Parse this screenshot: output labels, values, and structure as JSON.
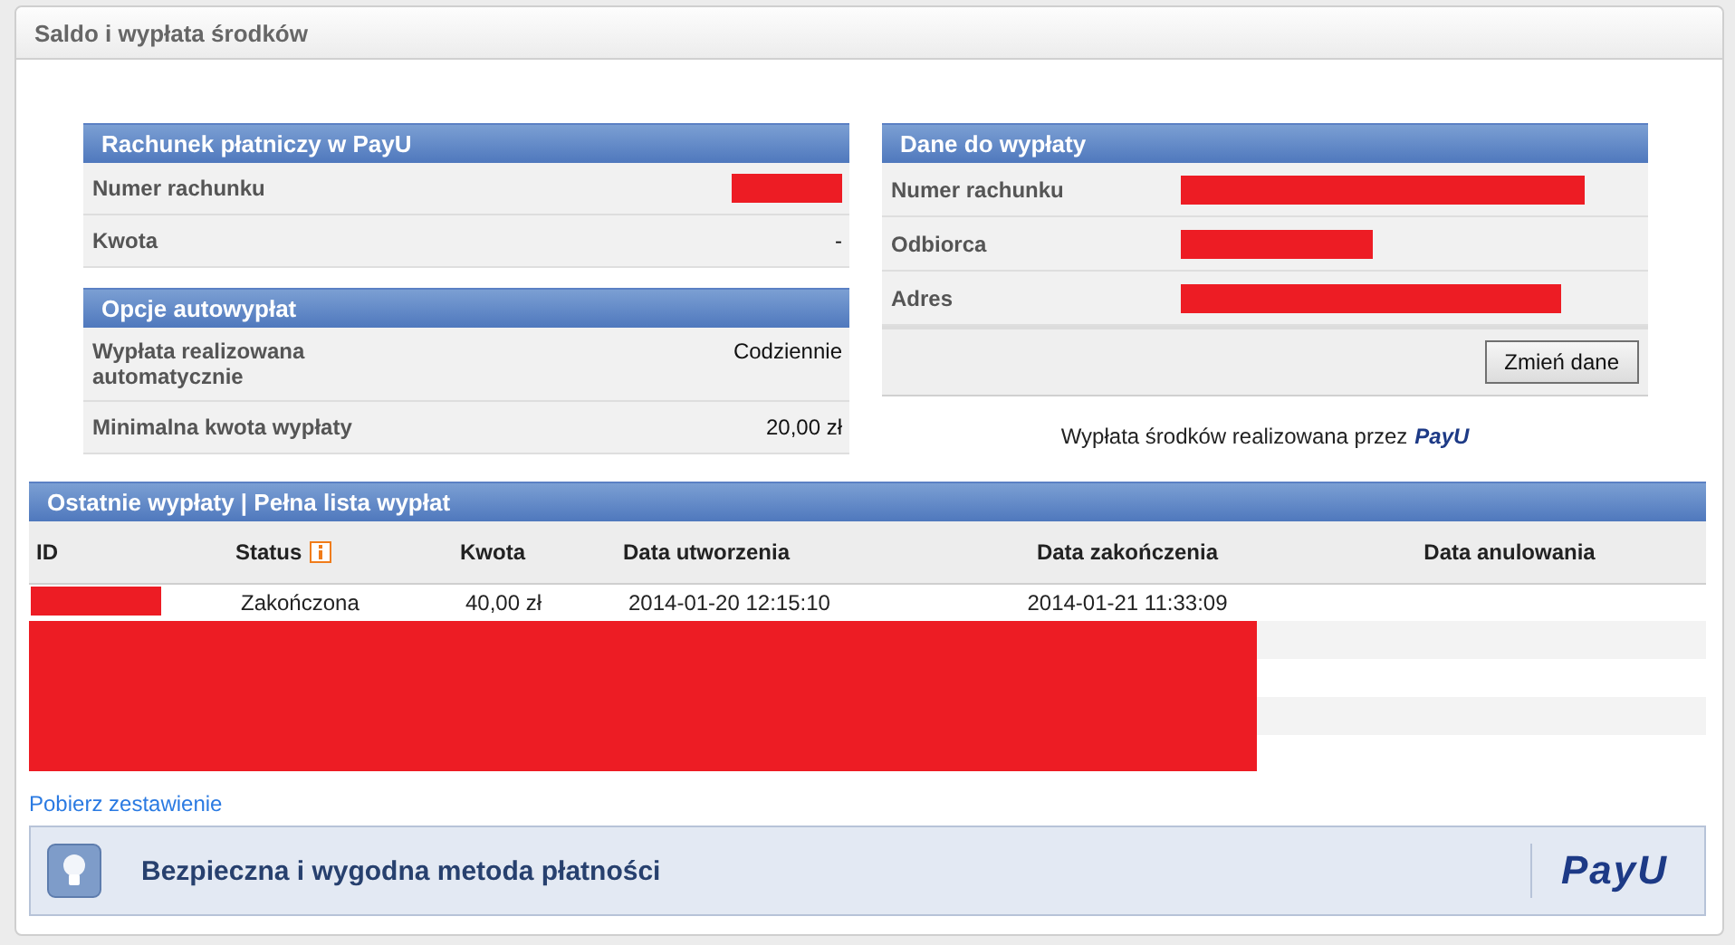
{
  "window": {
    "title": "Saldo i wypłata środków"
  },
  "payu_account": {
    "title": "Rachunek płatniczy w PayU",
    "rows": [
      {
        "label": "Numer rachunku",
        "redacted": true
      },
      {
        "label": "Kwota",
        "value": "-"
      }
    ]
  },
  "autopayout": {
    "title": "Opcje autowypłat",
    "rows": [
      {
        "label": "Wypłata realizowana automatycznie",
        "value": "Codziennie"
      },
      {
        "label": "Minimalna kwota wypłaty",
        "value": "20,00 zł"
      }
    ]
  },
  "payout_details": {
    "title": "Dane do wypłaty",
    "rows": [
      {
        "label": "Numer rachunku",
        "redacted": true
      },
      {
        "label": "Odbiorca",
        "redacted": true
      },
      {
        "label": "Adres",
        "redacted": true
      }
    ],
    "button": "Zmień dane",
    "note": "Wypłata środków realizowana przez",
    "logo": "PayU"
  },
  "payouts": {
    "title": "Ostatnie wypłaty | Pełna lista wypłat",
    "columns": [
      {
        "label": "ID"
      },
      {
        "label": "Status",
        "info": true
      },
      {
        "label": "Kwota"
      },
      {
        "label": "Data utworzenia"
      },
      {
        "label": "Data zakończenia"
      },
      {
        "label": "Data anulowania"
      }
    ],
    "rows": [
      {
        "id_redacted": true,
        "cells": [
          "",
          "Zakończona",
          "40,00 zł",
          "2014-01-20 12:15:10",
          "2014-01-21 11:33:09",
          ""
        ]
      }
    ],
    "rows_redacted": true,
    "link": "Pobierz zestawienie"
  },
  "banner": {
    "text": "Bezpieczna i wygodna metoda płatności",
    "logo": "PayU"
  }
}
